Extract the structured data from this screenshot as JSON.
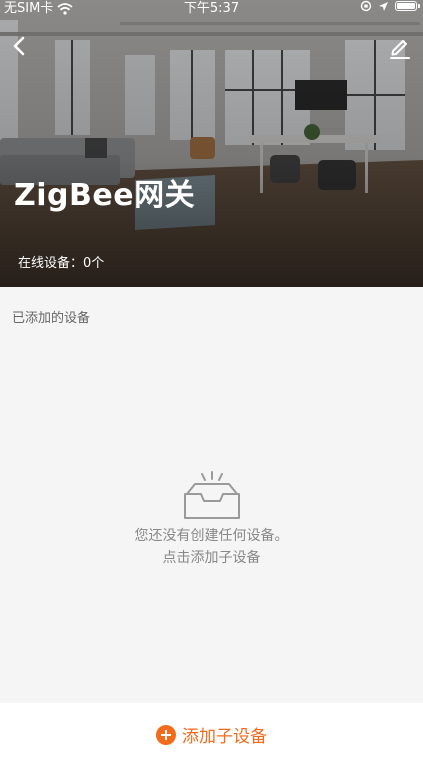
{
  "status_bar": {
    "carrier": "无SIM卡",
    "time": "下午5:37"
  },
  "hero": {
    "title": "ZigBee网关",
    "online_devices": "在线设备：0个",
    "background": "office-interior-photo"
  },
  "nav": {
    "back_icon": "chevron-left-icon",
    "edit_icon": "pencil-icon"
  },
  "devices": {
    "section_label": "已添加的设备",
    "empty_icon": "empty-inbox-icon",
    "empty_line1": "您还没有创建任何设备。",
    "empty_line2": "点击添加子设备"
  },
  "actions": {
    "add_sub_device": "添加子设备"
  },
  "colors": {
    "accent": "#f26a1b",
    "background": "#f5f5f5"
  }
}
